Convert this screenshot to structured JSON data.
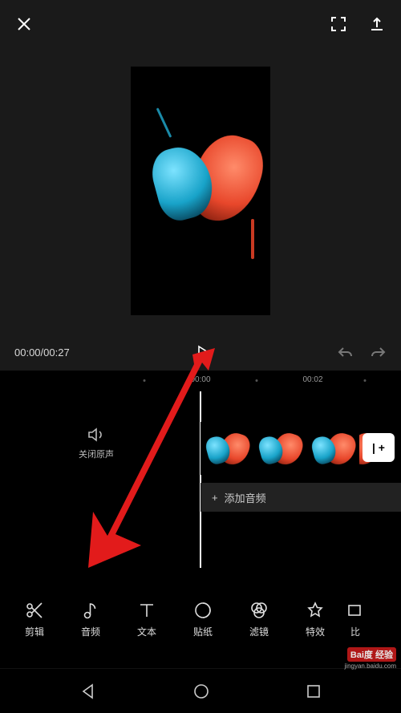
{
  "top": {
    "close": "close",
    "fullscreen": "fullscreen",
    "export": "export"
  },
  "playback": {
    "current": "00:00",
    "total": "00:27",
    "separator": "/"
  },
  "ruler": {
    "t0": "00:00",
    "t1": "00:02"
  },
  "mute": {
    "label": "关闭原声"
  },
  "addClip": {
    "label": "| +"
  },
  "audioTrack": {
    "plus": "+",
    "label": "添加音频"
  },
  "tools": [
    {
      "key": "edit",
      "label": "剪辑"
    },
    {
      "key": "audio",
      "label": "音频"
    },
    {
      "key": "text",
      "label": "文本"
    },
    {
      "key": "sticker",
      "label": "贴纸"
    },
    {
      "key": "filter",
      "label": "滤镜"
    },
    {
      "key": "effect",
      "label": "特效"
    },
    {
      "key": "ratio",
      "label": "比"
    }
  ],
  "watermark": {
    "brand": "Bai度 经验",
    "url": "jingyan.baidu.com"
  }
}
